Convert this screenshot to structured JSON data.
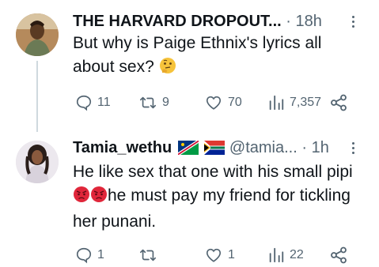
{
  "tweets": [
    {
      "name": "THE HARVARD DROPOUT...",
      "sep": "·",
      "time": "18h",
      "text": "But why is Paige Ethnix's lyrics all about sex?",
      "emoji": "thinking-face-icon",
      "stats": {
        "replies": "11",
        "retweets": "9",
        "likes": "70",
        "views": "7,357"
      }
    },
    {
      "name": "Tamia_wethu",
      "flags": [
        "namibia-flag-icon",
        "south-africa-flag-icon"
      ],
      "handle": "@tamia...",
      "sep": "·",
      "time": "1h",
      "text_line1": "He like sex that one with his small pipi",
      "emoji": "angry-face-icon",
      "text_rest": "he must pay my friend for tickling her punani.",
      "stats": {
        "replies": "1",
        "retweets": "",
        "likes": "1",
        "views": "22"
      }
    }
  ],
  "colors": {
    "text": "#0f1419",
    "muted": "#536471",
    "line": "#cfd9de"
  }
}
